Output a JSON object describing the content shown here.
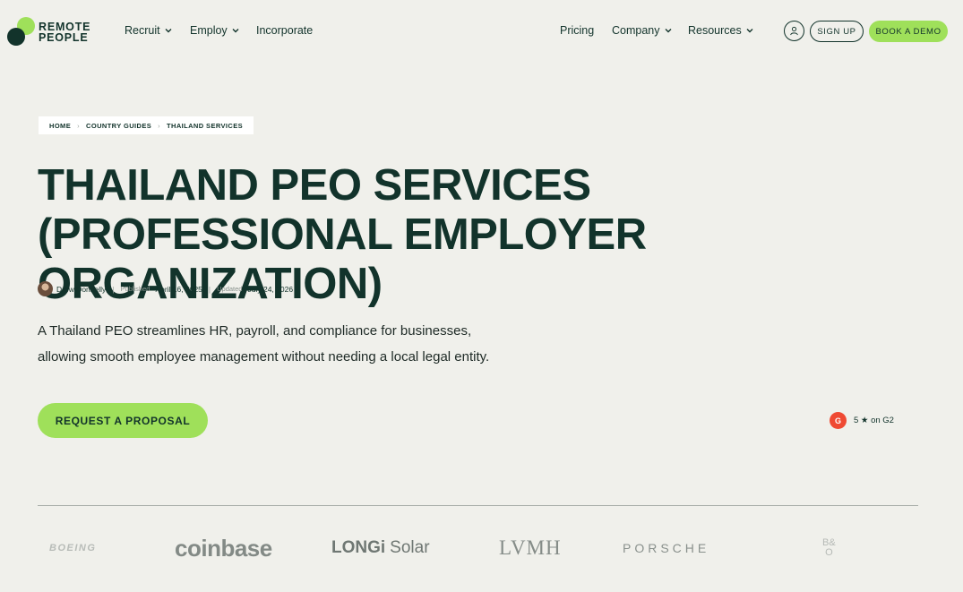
{
  "nav": {
    "logo_text_line1": "REMOTE",
    "logo_text_line2": "PEOPLE",
    "items": [
      "Recruit",
      "Employ",
      "Incorporate"
    ],
    "right_items": [
      "Pricing",
      "Company",
      "Resources"
    ],
    "signup_label": "SIGN UP",
    "demo_label": "BOOK A DEMO"
  },
  "breadcrumb": [
    "HOME",
    "COUNTRY GUIDES",
    "THAILAND SERVICES"
  ],
  "title": "THAILAND PEO SERVICES (PROFESSIONAL EMPLOYER ORGANIZATION)",
  "meta": {
    "author": "Drew Donnelly",
    "published_label": "Published",
    "published_date": "April 16, 2025",
    "updated_label": "Updated",
    "updated_date": "July 24, 2026"
  },
  "description_line1": "A Thailand PEO streamlines HR, payroll, and compliance for businesses,",
  "description_line2": "allowing smooth employee management without needing a local legal entity.",
  "cta_label": "REQUEST A PROPOSAL",
  "g2": {
    "badge": "G",
    "text": "5 ★ on G2"
  },
  "logos": [
    "BOEING",
    "coinbase",
    "LONGi",
    "Solar",
    "LVMH",
    "PORSCHE",
    "B&",
    "O"
  ],
  "colors": {
    "brand_dark": "#12332b",
    "accent_green": "#9fe05a",
    "background": "#f0f0eb",
    "g2_red": "#ef4a33"
  }
}
